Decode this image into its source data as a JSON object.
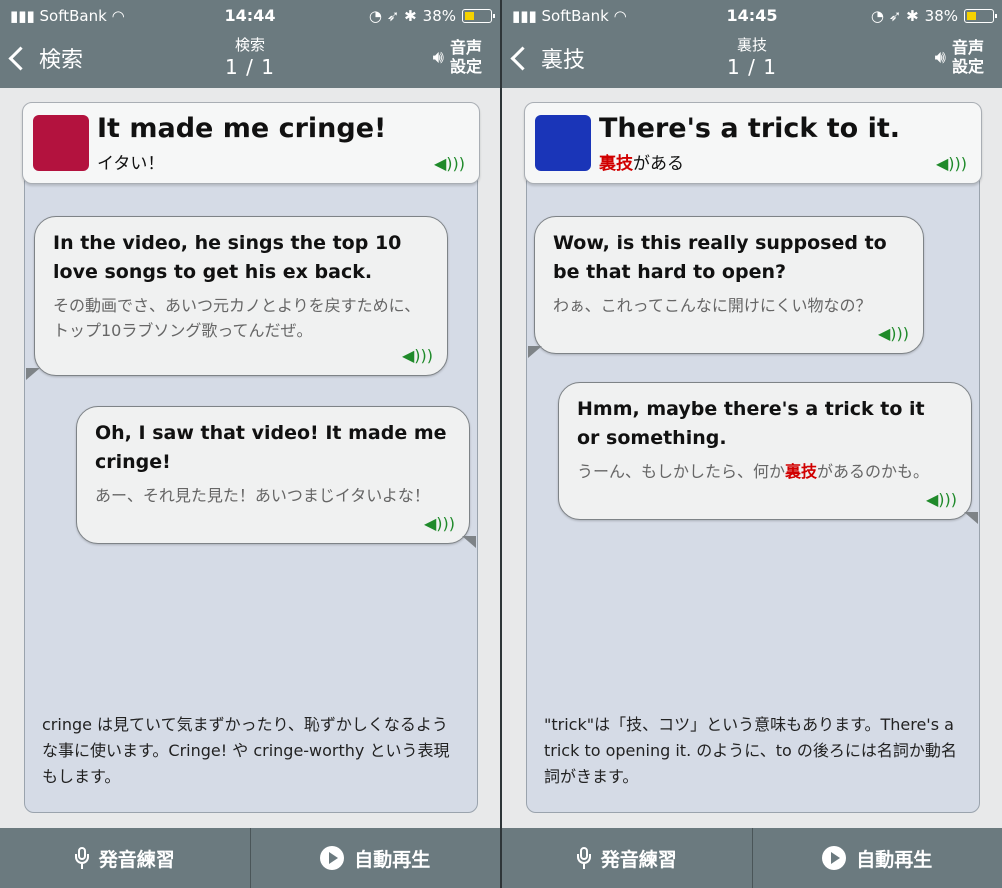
{
  "panels": [
    {
      "status": {
        "carrier": "SoftBank",
        "time": "14:44",
        "battery": "38%"
      },
      "nav": {
        "back_label": "検索",
        "title": "検索",
        "page": "1 / 1",
        "audio_label_1": "音声",
        "audio_label_2": "設定"
      },
      "head": {
        "title": "It made me cringe!",
        "subtitle": "イタい！",
        "color": "#b3123e"
      },
      "bubbles": [
        {
          "en": "In the video, he sings the top 10 love songs to get his ex back.",
          "ja": "その動画でさ、あいつ元カノとよりを戻すために、トップ10ラブソング歌ってんだぜ。"
        },
        {
          "en": "Oh, I saw that video! It made me cringe!",
          "ja": "あー、それ見た見た！あいつまじイタいよな！"
        }
      ],
      "note": "cringe は見ていて気まずかったり、恥ずかしくなるような事に使います。Cringe! や cringe-worthy という表現もします。",
      "toolbar": {
        "practice": "発音練習",
        "autoplay": "自動再生"
      }
    },
    {
      "status": {
        "carrier": "SoftBank",
        "time": "14:45",
        "battery": "38%"
      },
      "nav": {
        "back_label": "裏技",
        "title": "裏技",
        "page": "1 / 1",
        "audio_label_1": "音声",
        "audio_label_2": "設定"
      },
      "head": {
        "title": "There's a trick to it.",
        "subtitle_hl": "裏技",
        "subtitle_rest": "がある",
        "color": "#1a35b8"
      },
      "bubbles": [
        {
          "en": "Wow, is this really supposed to be that hard to open?",
          "ja": "わぁ、これってこんなに開けにくい物なの？"
        },
        {
          "en": "Hmm, maybe there's a trick to it or something.",
          "ja_pre": "うーん、もしかしたら、何か",
          "ja_hl": "裏技",
          "ja_post": "があるのかも。"
        }
      ],
      "note": "\"trick\"は「技、コツ」という意味もあります。There's a trick to opening it. のように、to の後ろには名詞か動名詞がきます。",
      "toolbar": {
        "practice": "発音練習",
        "autoplay": "自動再生"
      }
    }
  ],
  "icons": {
    "speaker": "speaker-icon",
    "mic": "microphone-icon",
    "play": "play-icon",
    "back": "chevron-left-icon"
  }
}
